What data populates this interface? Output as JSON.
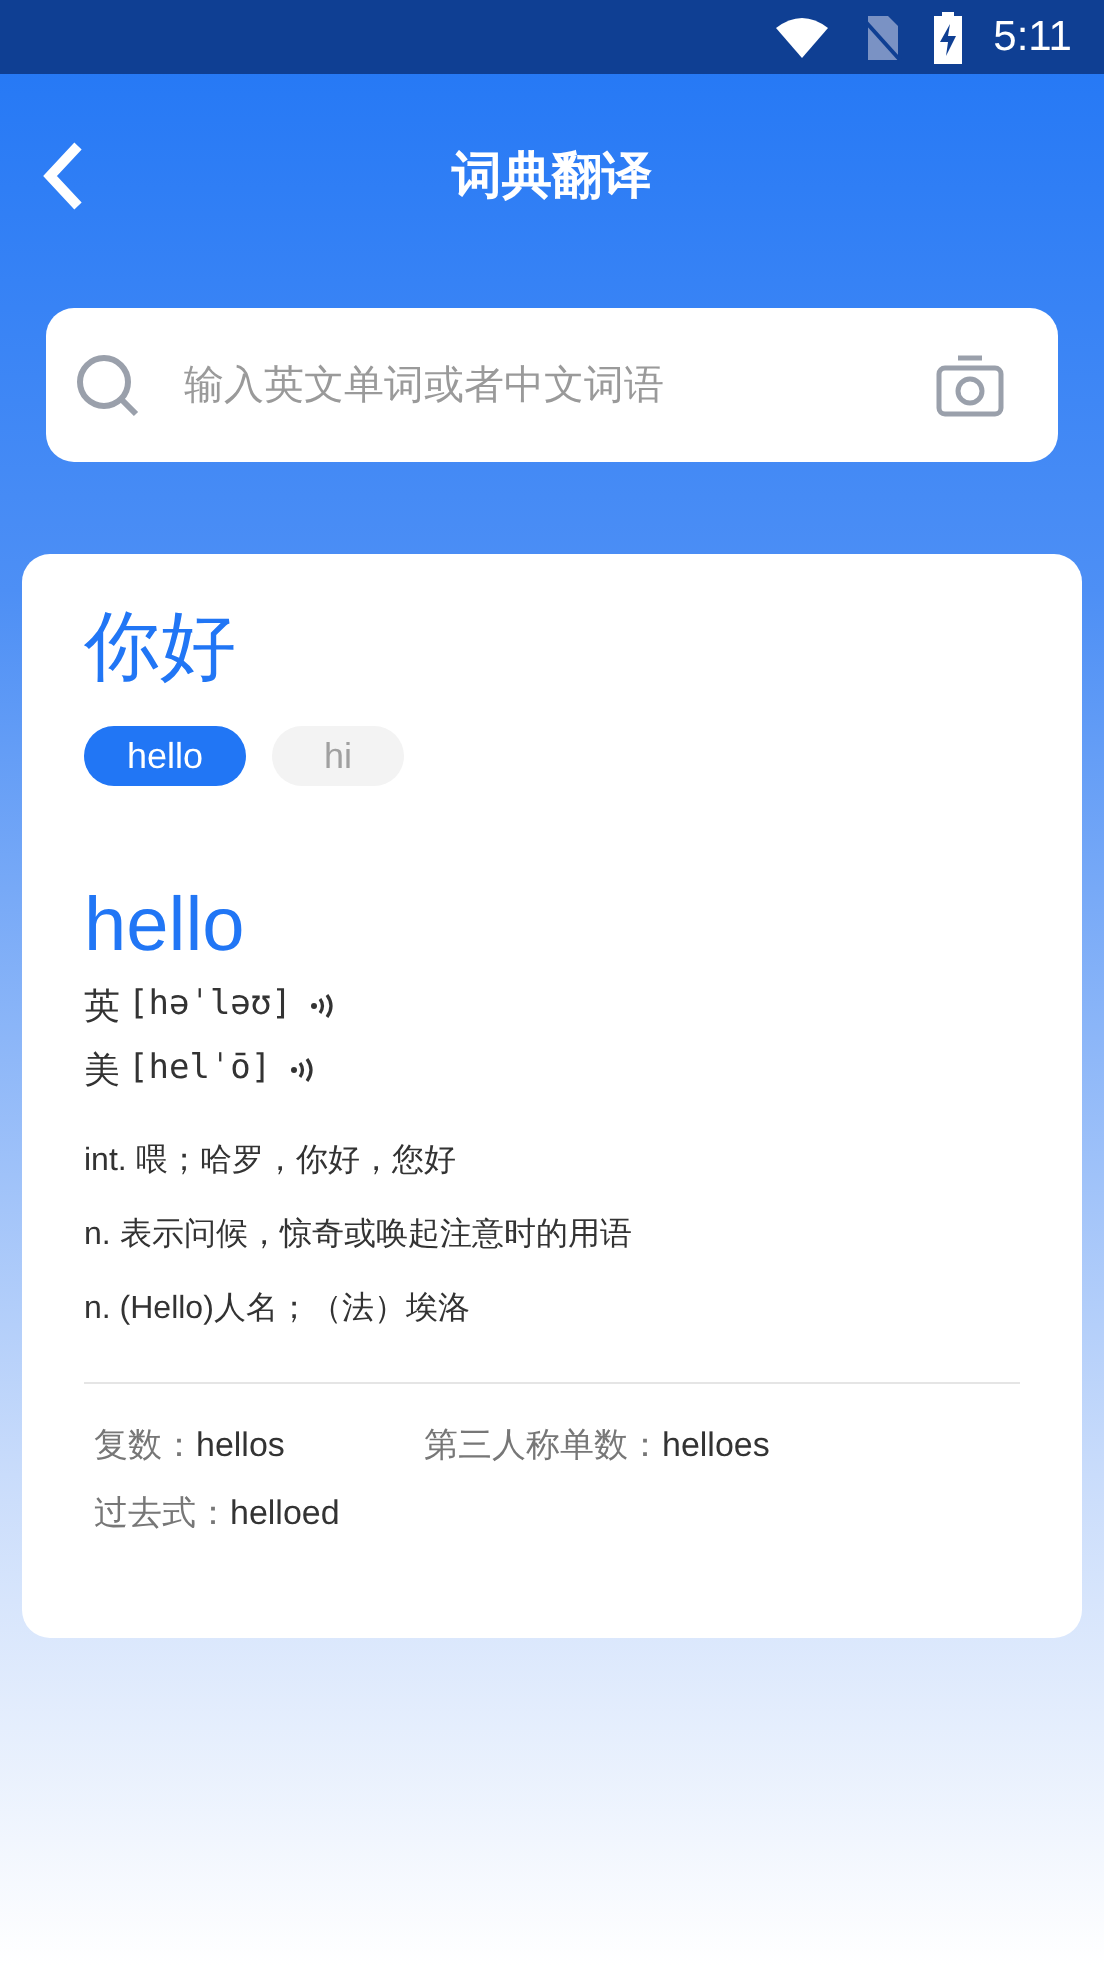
{
  "status_bar": {
    "time": "5:11"
  },
  "header": {
    "title": "词典翻译"
  },
  "search": {
    "placeholder": "输入英文单词或者中文词语"
  },
  "result": {
    "query": "你好",
    "chips": [
      {
        "label": "hello",
        "selected": true
      },
      {
        "label": "hi",
        "selected": false
      }
    ],
    "word": "hello",
    "pronunciations": [
      {
        "label": "英",
        "phonetic": "[həˈləʊ]"
      },
      {
        "label": "美",
        "phonetic": "[helˈō]"
      }
    ],
    "definitions": [
      "int. 喂；哈罗，你好，您好",
      "n. 表示问候，惊奇或唤起注意时的用语",
      "n. (Hello)人名；（法）埃洛"
    ],
    "forms": [
      {
        "label": "复数：",
        "value": "hellos"
      },
      {
        "label": "第三人称单数：",
        "value": "helloes"
      },
      {
        "label": "过去式：",
        "value": "helloed"
      }
    ]
  }
}
